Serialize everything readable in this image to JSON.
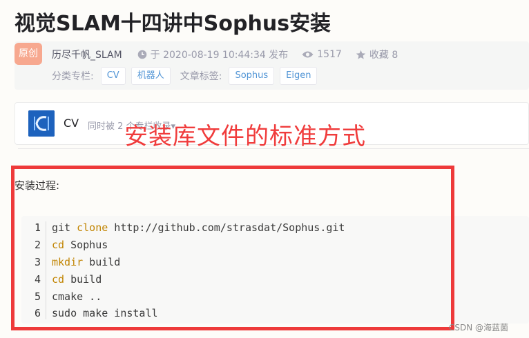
{
  "article": {
    "title": "视觉SLAM十四讲中Sophus安装"
  },
  "meta": {
    "original_badge": "原创",
    "author": "历尽千帆_SLAM",
    "publish": "于 2020-08-19 10:44:34 发布",
    "views": "1517",
    "favorites": "收藏 8",
    "category_label": "分类专栏:",
    "categories": [
      "CV",
      "机器人"
    ],
    "tags_label": "文章标签:",
    "tags": [
      "Sophus",
      "Eigen"
    ],
    "icons": [
      "clock-icon",
      "eye-icon",
      "star-icon"
    ]
  },
  "column": {
    "name": "CV",
    "description": "同时被 2 个专栏收录▾",
    "thumb_icon": "column-thumbnail-icon"
  },
  "annotation": {
    "caption": "安装库文件的标准方式",
    "color": "#f03c3c"
  },
  "content": {
    "heading": "安装过程:",
    "code_lines": [
      {
        "num": "1",
        "cmd": "git",
        "kw": "clone",
        "rest": " http://github.com/strasdat/Sophus.git"
      },
      {
        "num": "2",
        "cmd": "",
        "kw": "cd",
        "rest": " Sophus"
      },
      {
        "num": "3",
        "cmd": "",
        "kw": "mkdir",
        "rest": " build"
      },
      {
        "num": "4",
        "cmd": "",
        "kw": "cd",
        "rest": " build"
      },
      {
        "num": "5",
        "cmd": "cmake ..",
        "kw": "",
        "rest": ""
      },
      {
        "num": "6",
        "cmd": "sudo make install",
        "kw": "",
        "rest": ""
      }
    ]
  },
  "watermark": "CSDN @海蓝菌",
  "colors": {
    "accent_blue": "#5094d5",
    "badge": "#f7a88f",
    "keyword": "#c18401",
    "highlight_border": "#ee3a3a"
  }
}
